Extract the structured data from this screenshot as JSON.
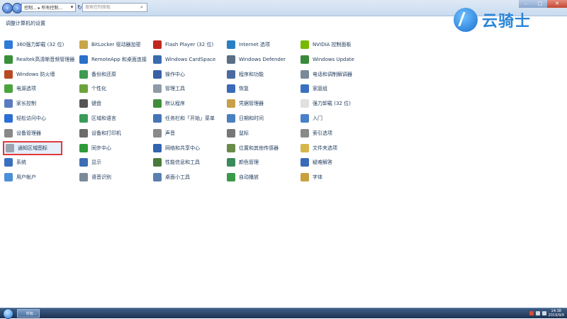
{
  "window": {
    "address_parts": "控制... ▸ 所有控制...",
    "search_placeholder": "搜索控制面板",
    "page_heading": "调整计算机的设置"
  },
  "logo": {
    "text": "云骑士"
  },
  "items": [
    {
      "label": "360强力卸载 (32 位)",
      "color": "#2d7bd6"
    },
    {
      "label": "Realtek高清晰音频管理器",
      "color": "#3b8f3b"
    },
    {
      "label": "Windows 防火墙",
      "color": "#b84a22"
    },
    {
      "label": "电源选项",
      "color": "#4aa43d"
    },
    {
      "label": "家长控制",
      "color": "#5a7bc2"
    },
    {
      "label": "轻松访问中心",
      "color": "#2b6ed4"
    },
    {
      "label": "设备管理器",
      "color": "#888888"
    },
    {
      "label": "通知区域图标",
      "color": "#9aa5b1"
    },
    {
      "label": "系统",
      "color": "#3a6fc0"
    },
    {
      "label": "用户帐户",
      "color": "#4b8fd8"
    },
    {
      "label": "BitLocker 驱动器加密",
      "color": "#c9a54a"
    },
    {
      "label": "RemoteApp 和桌面连接",
      "color": "#2c6fc9"
    },
    {
      "label": "备份和还原",
      "color": "#3f9b50"
    },
    {
      "label": "个性化",
      "color": "#6aa33b"
    },
    {
      "label": "键盘",
      "color": "#555555"
    },
    {
      "label": "区域和语言",
      "color": "#3a9a5a"
    },
    {
      "label": "设备和打印机",
      "color": "#6b6b6b"
    },
    {
      "label": "同步中心",
      "color": "#2e9a3a"
    },
    {
      "label": "显示",
      "color": "#3d6db5"
    },
    {
      "label": "语音识别",
      "color": "#7a8a99"
    },
    {
      "label": "Flash Player (32 位)",
      "color": "#c0281f"
    },
    {
      "label": "Windows CardSpace",
      "color": "#3a6ab0"
    },
    {
      "label": "操作中心",
      "color": "#3a5fa8"
    },
    {
      "label": "管理工具",
      "color": "#8d9aa8"
    },
    {
      "label": "默认程序",
      "color": "#3f8e3a"
    },
    {
      "label": "任务栏和「开始」菜单",
      "color": "#4474b5"
    },
    {
      "label": "声音",
      "color": "#8a8a8a"
    },
    {
      "label": "网络和共享中心",
      "color": "#3264b0"
    },
    {
      "label": "性能信息和工具",
      "color": "#4a7a3a"
    },
    {
      "label": "桌面小工具",
      "color": "#5a7fb0"
    },
    {
      "label": "Internet 选项",
      "color": "#2a7fc4"
    },
    {
      "label": "Windows Defender",
      "color": "#5a6f85"
    },
    {
      "label": "程序和功能",
      "color": "#4b6aa0"
    },
    {
      "label": "恢复",
      "color": "#3a6ab8"
    },
    {
      "label": "凭据管理器",
      "color": "#c9a04a"
    },
    {
      "label": "日期和时间",
      "color": "#4a80c0"
    },
    {
      "label": "鼠标",
      "color": "#777777"
    },
    {
      "label": "位置和其他传感器",
      "color": "#6a8a4a"
    },
    {
      "label": "颜色管理",
      "color": "#3a8a5a"
    },
    {
      "label": "自动播放",
      "color": "#3a9a4a"
    },
    {
      "label": "NVIDIA 控制面板",
      "color": "#76b900"
    },
    {
      "label": "Windows Update",
      "color": "#3a8a3a"
    },
    {
      "label": "电话和调制解调器",
      "color": "#7a8a99"
    },
    {
      "label": "家庭组",
      "color": "#3a70c0"
    },
    {
      "label": "强力卸载 (32 位)",
      "color": "#e0e0e0"
    },
    {
      "label": "入门",
      "color": "#4a80c8"
    },
    {
      "label": "索引选项",
      "color": "#8a8a8a"
    },
    {
      "label": "文件夹选项",
      "color": "#d7b54a"
    },
    {
      "label": "疑难解答",
      "color": "#3a6ab8"
    },
    {
      "label": "字体",
      "color": "#c8a040"
    }
  ],
  "taskbar": {
    "app_label": "所有...",
    "time": "14:38",
    "date": "2019/9/9"
  }
}
